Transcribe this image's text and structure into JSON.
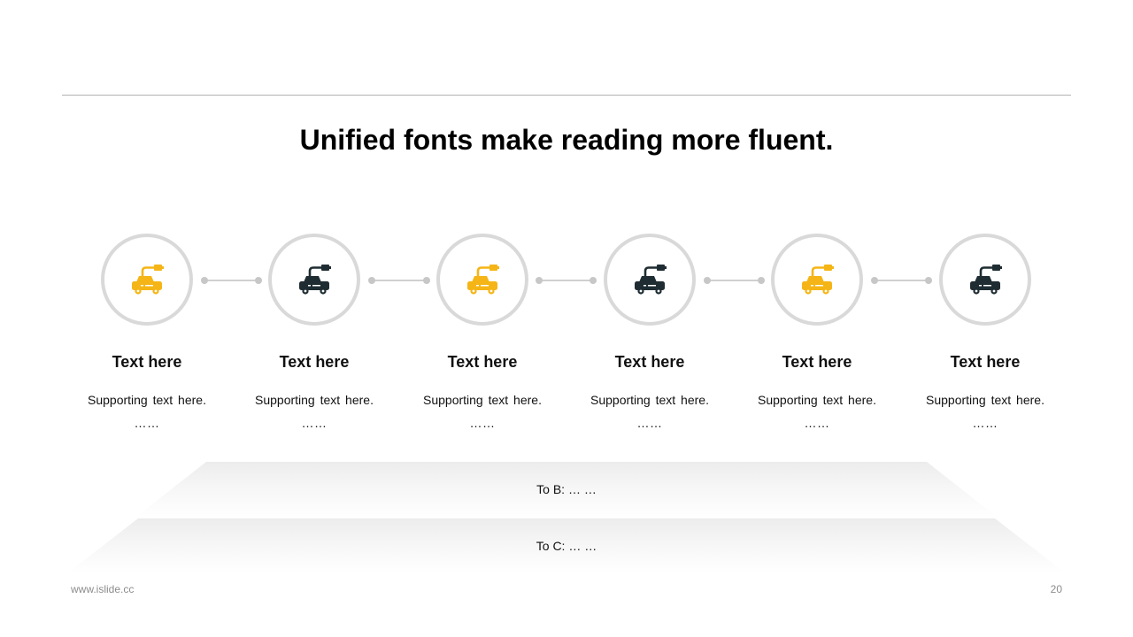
{
  "title": "Unified fonts make reading more fluent.",
  "colors": {
    "accent": "#f5b516",
    "dark": "#1f2d33",
    "ring": "#d9d9d9"
  },
  "steps": [
    {
      "title": "Text here",
      "subtitle": "Supporting text here.",
      "dots": "……",
      "icon": "electric-car-icon",
      "color": "accent"
    },
    {
      "title": "Text here",
      "subtitle": "Supporting text here.",
      "dots": "……",
      "icon": "electric-car-icon",
      "color": "dark"
    },
    {
      "title": "Text here",
      "subtitle": "Supporting text here.",
      "dots": "……",
      "icon": "electric-car-icon",
      "color": "accent"
    },
    {
      "title": "Text here",
      "subtitle": "Supporting text here.",
      "dots": "……",
      "icon": "electric-car-icon",
      "color": "dark"
    },
    {
      "title": "Text here",
      "subtitle": "Supporting text here.",
      "dots": "……",
      "icon": "electric-car-icon",
      "color": "accent"
    },
    {
      "title": "Text here",
      "subtitle": "Supporting text here.",
      "dots": "……",
      "icon": "electric-car-icon",
      "color": "dark"
    }
  ],
  "bands": [
    {
      "label": "To B: … …"
    },
    {
      "label": "To C: … …"
    }
  ],
  "footer": {
    "website": "www.islide.cc",
    "page_number": "20"
  }
}
